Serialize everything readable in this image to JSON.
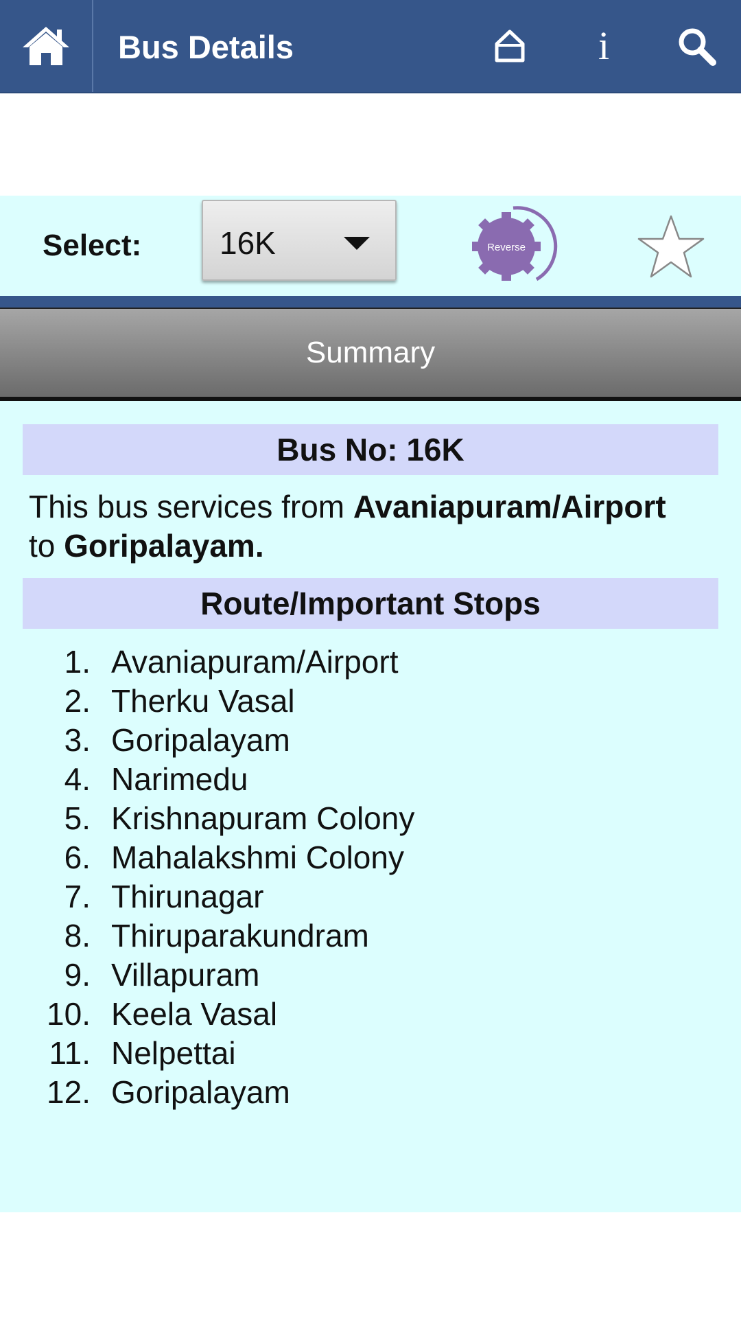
{
  "header": {
    "title": "Bus Details",
    "home_icon": "home-icon",
    "right_icons": [
      "house-outline-icon",
      "info-icon",
      "search-icon"
    ],
    "info_glyph": "i",
    "bg_color": "#36568a"
  },
  "selector": {
    "label": "Select:",
    "value": "16K",
    "reverse_label": "Reverse",
    "favorite_icon": "star-outline-icon"
  },
  "summary": {
    "label": "Summary"
  },
  "details": {
    "bus_no_label": "Bus No: 16K",
    "desc_prefix": "This bus services from ",
    "from": "Avaniapuram/Airport",
    "desc_mid": " to ",
    "to": "Goripalayam.",
    "route_title": "Route/Important Stops",
    "stops": [
      {
        "num": "1.",
        "name": "Avaniapuram/Airport"
      },
      {
        "num": "2.",
        "name": "Therku Vasal"
      },
      {
        "num": "3.",
        "name": "Goripalayam"
      },
      {
        "num": "4.",
        "name": "Narimedu"
      },
      {
        "num": "5.",
        "name": "Krishnapuram Colony"
      },
      {
        "num": "6.",
        "name": "Mahalakshmi Colony"
      },
      {
        "num": "7.",
        "name": "Thirunagar"
      },
      {
        "num": "8.",
        "name": "Thiruparakundram"
      },
      {
        "num": "9.",
        "name": "Villapuram"
      },
      {
        "num": "10.",
        "name": "Keela Vasal"
      },
      {
        "num": "11.",
        "name": "Nelpettai"
      },
      {
        "num": "12.",
        "name": "Goripalayam"
      }
    ]
  },
  "colors": {
    "content_bg": "#dcfefe",
    "header_box_bg": "#d3d8fa",
    "reverse_purple": "#8a6bb0"
  }
}
